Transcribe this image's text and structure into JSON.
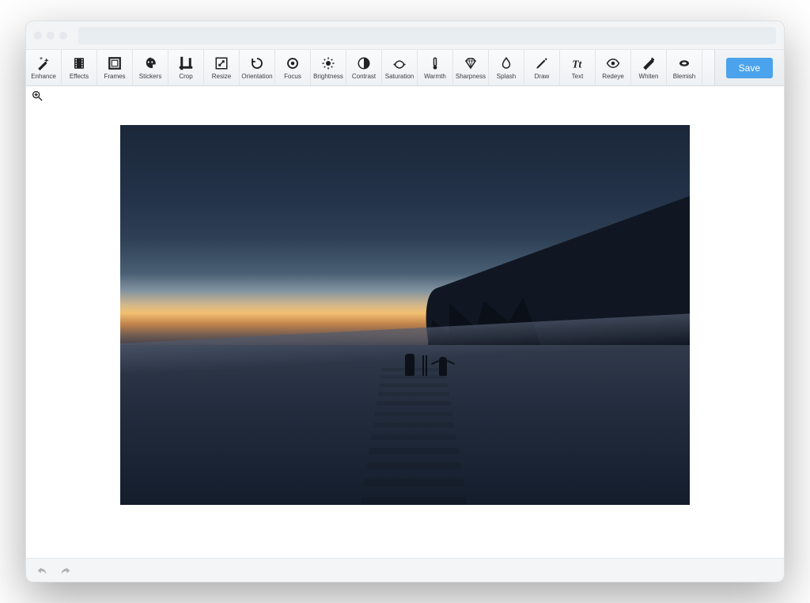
{
  "app": {
    "save_label": "Save"
  },
  "toolbar": [
    {
      "key": "enhance",
      "label": "Enhance",
      "icon": "wand-icon"
    },
    {
      "key": "effects",
      "label": "Effects",
      "icon": "film-icon"
    },
    {
      "key": "frames",
      "label": "Frames",
      "icon": "frame-icon"
    },
    {
      "key": "stickers",
      "label": "Stickers",
      "icon": "sticker-icon"
    },
    {
      "key": "crop",
      "label": "Crop",
      "icon": "crop-icon"
    },
    {
      "key": "resize",
      "label": "Resize",
      "icon": "resize-icon"
    },
    {
      "key": "orientation",
      "label": "Orientation",
      "icon": "rotate-icon"
    },
    {
      "key": "focus",
      "label": "Focus",
      "icon": "focus-icon"
    },
    {
      "key": "brightness",
      "label": "Brightness",
      "icon": "sun-icon"
    },
    {
      "key": "contrast",
      "label": "Contrast",
      "icon": "contrast-icon"
    },
    {
      "key": "saturation",
      "label": "Saturation",
      "icon": "saturation-icon"
    },
    {
      "key": "warmth",
      "label": "Warmth",
      "icon": "thermometer-icon"
    },
    {
      "key": "sharpness",
      "label": "Sharpness",
      "icon": "diamond-icon"
    },
    {
      "key": "splash",
      "label": "Splash",
      "icon": "splash-icon"
    },
    {
      "key": "draw",
      "label": "Draw",
      "icon": "pencil-icon"
    },
    {
      "key": "text",
      "label": "Text",
      "icon": "text-icon"
    },
    {
      "key": "redeye",
      "label": "Redeye",
      "icon": "eye-icon"
    },
    {
      "key": "whiten",
      "label": "Whiten",
      "icon": "whiten-icon"
    },
    {
      "key": "blemish",
      "label": "Blemish",
      "icon": "blemish-icon"
    }
  ],
  "colors": {
    "accent": "#4aa3ec",
    "toolbar_bg_top": "#fafbfc",
    "toolbar_bg_bottom": "#eef1f3"
  }
}
